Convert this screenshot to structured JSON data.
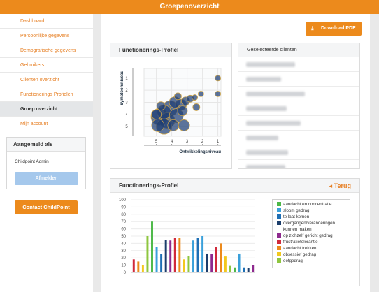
{
  "header": {
    "title": "Groepenoverzicht"
  },
  "sidebar": {
    "items": [
      {
        "label": "Dashboard",
        "active": false
      },
      {
        "label": "Persoonlijke gegevens",
        "active": false
      },
      {
        "label": "Demografische gegevens",
        "active": false
      },
      {
        "label": "Gebruikers",
        "active": false
      },
      {
        "label": "Cliënten overzicht",
        "active": false
      },
      {
        "label": "Functionerings Profielen",
        "active": false
      },
      {
        "label": "Groep overzicht",
        "active": true
      },
      {
        "label": "Mijn account",
        "active": false
      }
    ],
    "login": {
      "title": "Aangemeld als",
      "user": "Childpoint Admin",
      "logout_label": "Afmelden"
    },
    "contact_label": "Contact ChildPoint"
  },
  "toolbar": {
    "download_label": "Download PDF"
  },
  "scatter_panel": {
    "title": "Functionerings-Profiel"
  },
  "clients_panel": {
    "title": "Geselecteerde cliënten",
    "blurred_rows": 8
  },
  "bar_panel": {
    "title": "Functionerings-Profiel",
    "back_label": "Terug"
  },
  "colors": {
    "accent": "#ec8a1c",
    "logout": "#a5c8ec"
  },
  "chart_data": [
    {
      "type": "scatter",
      "xlabel": "Ontwikkelingsniveau",
      "ylabel": "Symptoomniveau",
      "x_ticks": [
        "5",
        "4",
        "3",
        "2",
        "1"
      ],
      "y_ticks": [
        "1",
        "2",
        "3",
        "4",
        "5"
      ],
      "xlim": [
        5.8,
        0.8
      ],
      "ylim": [
        0.2,
        5.8
      ],
      "grid": true,
      "points": [
        {
          "x": 1.0,
          "y": 1.0,
          "size": 4
        },
        {
          "x": 1.0,
          "y": 2.3,
          "size": 4
        },
        {
          "x": 2.1,
          "y": 2.3,
          "size": 4
        },
        {
          "x": 2.5,
          "y": 2.6,
          "size": 4
        },
        {
          "x": 2.8,
          "y": 2.7,
          "size": 5
        },
        {
          "x": 3.1,
          "y": 2.9,
          "size": 6
        },
        {
          "x": 3.4,
          "y": 3.2,
          "size": 8
        },
        {
          "x": 3.8,
          "y": 3.0,
          "size": 8
        },
        {
          "x": 4.1,
          "y": 3.5,
          "size": 11
        },
        {
          "x": 4.5,
          "y": 3.8,
          "size": 10
        },
        {
          "x": 4.8,
          "y": 4.2,
          "size": 12
        },
        {
          "x": 4.3,
          "y": 4.5,
          "size": 11
        },
        {
          "x": 3.7,
          "y": 4.1,
          "size": 10
        },
        {
          "x": 3.3,
          "y": 3.7,
          "size": 7
        },
        {
          "x": 4.9,
          "y": 4.9,
          "size": 9
        },
        {
          "x": 4.5,
          "y": 5.0,
          "size": 11
        },
        {
          "x": 3.9,
          "y": 4.9,
          "size": 8
        },
        {
          "x": 3.2,
          "y": 4.9,
          "size": 8
        },
        {
          "x": 4.7,
          "y": 3.3,
          "size": 6
        },
        {
          "x": 3.6,
          "y": 2.5,
          "size": 5
        },
        {
          "x": 2.4,
          "y": 3.4,
          "size": 5
        },
        {
          "x": 5.0,
          "y": 4.0,
          "size": 7
        }
      ]
    },
    {
      "type": "bar",
      "ylim": [
        0,
        100
      ],
      "y_ticks": [
        "0",
        "10",
        "20",
        "30",
        "40",
        "50",
        "60",
        "70",
        "80",
        "90",
        "100"
      ],
      "grid": true,
      "legend": "right",
      "series": [
        {
          "name": "aandacht en concentratie",
          "color": "#4cb848"
        },
        {
          "name": "sloom gedrag",
          "color": "#3aa0da"
        },
        {
          "name": "te laat komen",
          "color": "#1e6fb5"
        },
        {
          "name": "overgangen/veranderingen kunnen maken",
          "color": "#1b3d6b"
        },
        {
          "name": "op zichzelf gericht gedrag",
          "color": "#8e2a8e"
        },
        {
          "name": "frustratietolerantie",
          "color": "#d0293b"
        },
        {
          "name": "aandacht trekken",
          "color": "#ec8a1c"
        },
        {
          "name": "obsessief gedrag",
          "color": "#f2c81e"
        },
        {
          "name": "eetgedrag",
          "color": "#8ec63f"
        }
      ],
      "bars": [
        {
          "series": 5,
          "value": 18
        },
        {
          "series": 6,
          "value": 15
        },
        {
          "series": 7,
          "value": 10
        },
        {
          "series": 8,
          "value": 50
        },
        {
          "series": 0,
          "value": 70
        },
        {
          "series": 1,
          "value": 35
        },
        {
          "series": 2,
          "value": 25
        },
        {
          "series": 3,
          "value": 45
        },
        {
          "series": 4,
          "value": 44
        },
        {
          "series": 5,
          "value": 48
        },
        {
          "series": 6,
          "value": 48
        },
        {
          "series": 7,
          "value": 18
        },
        {
          "series": 8,
          "value": 23
        },
        {
          "series": 1,
          "value": 44
        },
        {
          "series": 2,
          "value": 48
        },
        {
          "series": 1,
          "value": 50
        },
        {
          "series": 3,
          "value": 26
        },
        {
          "series": 4,
          "value": 25
        },
        {
          "series": 5,
          "value": 35
        },
        {
          "series": 6,
          "value": 40
        },
        {
          "series": 7,
          "value": 22
        },
        {
          "series": 8,
          "value": 9
        },
        {
          "series": 0,
          "value": 7
        },
        {
          "series": 1,
          "value": 26
        },
        {
          "series": 2,
          "value": 7
        },
        {
          "series": 3,
          "value": 6
        },
        {
          "series": 4,
          "value": 10
        }
      ]
    }
  ]
}
